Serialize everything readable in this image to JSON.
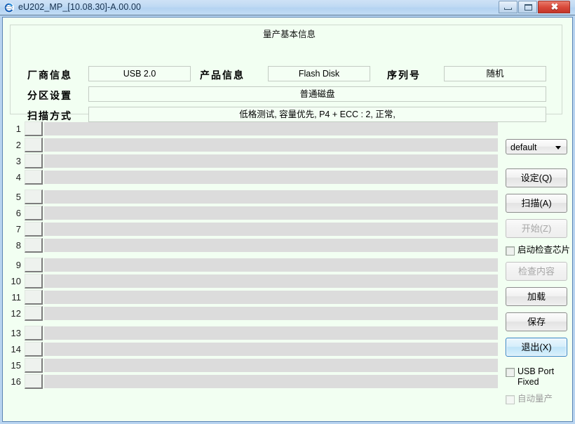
{
  "window": {
    "title": "eU202_MP_[10.08.30]-A.00.00",
    "icon": "app-swirl-icon",
    "minimize_label": "Minimize",
    "maximize_label": "Maximize",
    "close_label": "✖",
    "background_color": "#f2fff2",
    "border_color": "#5b85b5",
    "titlebar_color": "#bfd9f3"
  },
  "groupbox": {
    "title": "量产基本信息",
    "fields": [
      {
        "label": "厂商信息",
        "value": "USB 2.0"
      },
      {
        "label": "产品信息",
        "value": "Flash Disk"
      },
      {
        "label": "序列号",
        "value": "随机"
      },
      {
        "label": "分区设置",
        "value": "普通磁盘"
      },
      {
        "label": "扫描方式",
        "value": "低格测试, 容量优先, P4 + ECC : 2, 正常,"
      }
    ]
  },
  "rows": [
    {
      "index": "1",
      "status": ""
    },
    {
      "index": "2",
      "status": ""
    },
    {
      "index": "3",
      "status": ""
    },
    {
      "index": "4",
      "status": ""
    },
    {
      "index": "5",
      "status": ""
    },
    {
      "index": "6",
      "status": ""
    },
    {
      "index": "7",
      "status": ""
    },
    {
      "index": "8",
      "status": ""
    },
    {
      "index": "9",
      "status": ""
    },
    {
      "index": "10",
      "status": ""
    },
    {
      "index": "11",
      "status": ""
    },
    {
      "index": "12",
      "status": ""
    },
    {
      "index": "13",
      "status": ""
    },
    {
      "index": "14",
      "status": ""
    },
    {
      "index": "15",
      "status": ""
    },
    {
      "index": "16",
      "status": ""
    }
  ],
  "sidepanel": {
    "preset_combo": {
      "value": "default",
      "arrow_icon": "chevron-down-icon"
    },
    "buttons": [
      {
        "name": "settings",
        "label": "设定(Q)",
        "state": "enabled"
      },
      {
        "name": "scan",
        "label": "扫描(A)",
        "state": "enabled"
      },
      {
        "name": "start",
        "label": "开始(Z)",
        "state": "disabled"
      },
      {
        "name": "check-content",
        "label": "检查内容",
        "state": "disabled"
      },
      {
        "name": "load",
        "label": "加载",
        "state": "enabled"
      },
      {
        "name": "save",
        "label": "保存",
        "state": "enabled"
      },
      {
        "name": "exit",
        "label": "退出(X)",
        "state": "focused"
      }
    ],
    "checkboxes": [
      {
        "name": "enable-chip-check",
        "label": "启动检查芯片",
        "checked": false,
        "disabled": false
      },
      {
        "name": "usb-port-fixed",
        "label": "USB Port Fixed",
        "checked": false,
        "disabled": false
      },
      {
        "name": "auto-production",
        "label": "自动量产",
        "checked": false,
        "disabled": true
      }
    ]
  }
}
